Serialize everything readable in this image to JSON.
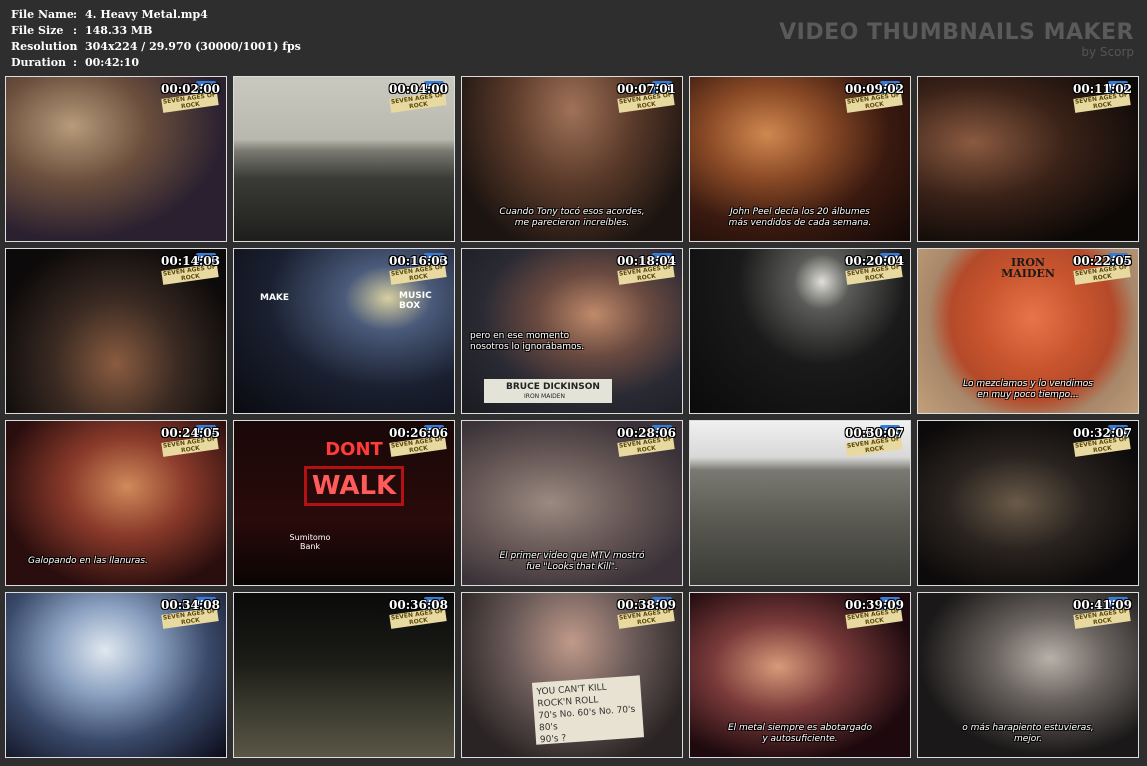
{
  "file_info": {
    "rows": [
      {
        "label": "File Name",
        "value": "4. Heavy Metal.mp4"
      },
      {
        "label": "File Size",
        "value": "148.33 MB"
      },
      {
        "label": "Resolution",
        "value": "304x224 / 29.970 (30000/1001) fps"
      },
      {
        "label": "Duration",
        "value": "00:42:10"
      }
    ]
  },
  "brand": {
    "title": "VIDEO THUMBNAILS MAKER",
    "subtitle": "by Scorp"
  },
  "overlay": {
    "channel_logo": "VH1",
    "badge_text": "SEVEN AGES OF ROCK"
  },
  "colors": {
    "background": "#2e2e2e",
    "thumb_border": "#dcdcdc",
    "brand_text": "#5a5a5a"
  },
  "thumbnails": [
    {
      "time": "00:02:00",
      "subtitle": "",
      "scene": "band-closeup"
    },
    {
      "time": "00:04:00",
      "subtitle": "",
      "scene": "city-skyline"
    },
    {
      "time": "00:07:01",
      "subtitle": "Cuando Tony tocó esos acordes,\nme parecieron increíbles.",
      "scene": "stage-band"
    },
    {
      "time": "00:09:02",
      "subtitle": "John Peel decía los 20 álbumes\nmás vendidos de cada semana.",
      "scene": "blurred-face"
    },
    {
      "time": "00:11:02",
      "subtitle": "",
      "scene": "stage-guitarists"
    },
    {
      "time": "00:14:03",
      "subtitle": "",
      "scene": "concert-stage"
    },
    {
      "time": "00:16:03",
      "subtitle": "",
      "scene": "night-street",
      "signs": [
        "MAKE",
        "MUSIC BOX"
      ]
    },
    {
      "time": "00:18:04",
      "subtitle": "pero en ese momento\nnosotros lo ignorábamos.",
      "scene": "interview",
      "lower_third_name": "BRUCE DICKINSON",
      "lower_third_role": "IRON MAIDEN"
    },
    {
      "time": "00:20:04",
      "subtitle": "",
      "scene": "subway-tunnel"
    },
    {
      "time": "00:22:05",
      "subtitle": "Lo mezclamos y lo vendimos\nen muy poco tiempo...",
      "scene": "iron-maiden-record",
      "logo_text": "IRON MAIDEN"
    },
    {
      "time": "00:24:05",
      "subtitle": "Galopando en las llanuras.",
      "scene": "singer-mic"
    },
    {
      "time": "00:26:06",
      "subtitle": "",
      "scene": "dont-walk-sign",
      "sign_top": "DONT",
      "sign_bottom": "WALK",
      "bank_name": "Sumitomo Bank"
    },
    {
      "time": "00:28:06",
      "subtitle": "El primer video que MTV mostró\nfue \"Looks that Kill\".",
      "scene": "music-video"
    },
    {
      "time": "00:30:07",
      "subtitle": "",
      "scene": "railroad-tracks"
    },
    {
      "time": "00:32:07",
      "subtitle": "",
      "scene": "dark-hair"
    },
    {
      "time": "00:34:08",
      "subtitle": "",
      "scene": "performer-lights"
    },
    {
      "time": "00:36:08",
      "subtitle": "",
      "scene": "playground"
    },
    {
      "time": "00:38:09",
      "subtitle": "",
      "scene": "protest-sign",
      "sign_text": "YOU CAN'T KILL ROCK'N ROLL\n70's No. 60's No. 70's 80's\n90's ?"
    },
    {
      "time": "00:39:09",
      "subtitle": "El metal siempre es abotargado\ny autosuficiente.",
      "scene": "screaming-singer"
    },
    {
      "time": "00:41:09",
      "subtitle": "o más harapiento estuvieras,\nmejor.",
      "scene": "headbanger"
    }
  ]
}
